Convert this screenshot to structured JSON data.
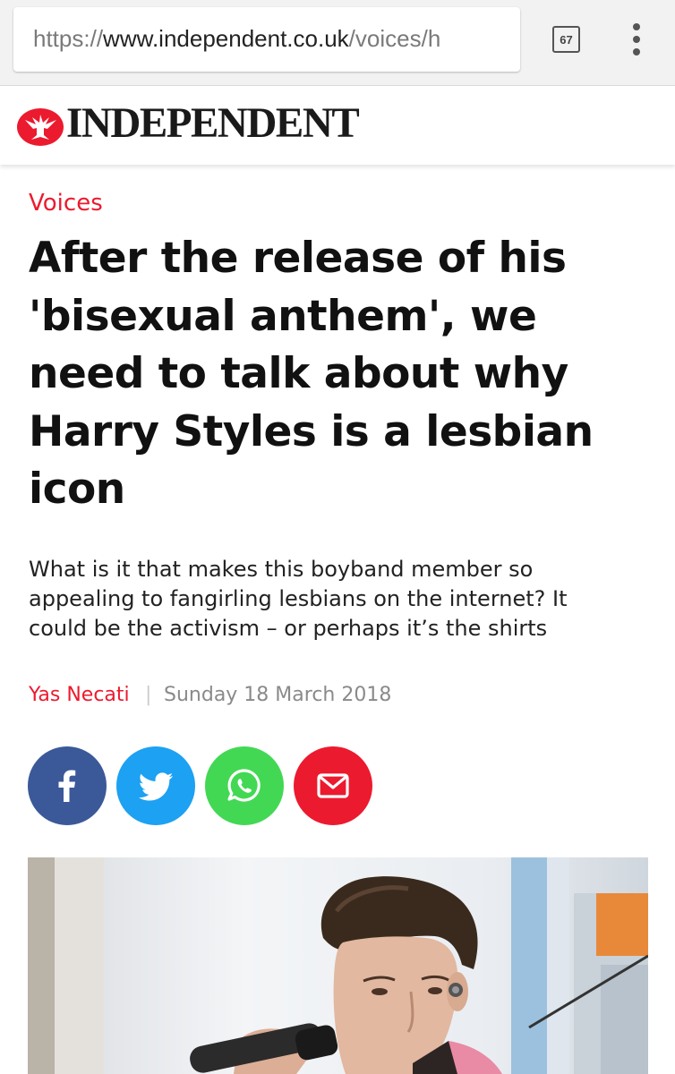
{
  "browser": {
    "url_scheme": "https://",
    "url_host": "www.independent.co.uk",
    "url_path": "/voices/h",
    "tab_count": "67"
  },
  "masthead": {
    "brand": "INDEPENDENT",
    "brand_color": "#ec1a2e"
  },
  "article": {
    "section": "Voices",
    "headline_lines": [
      "After the release of his",
      "'bisexual anthem', we",
      "need to talk about why",
      "Harry Styles is a lesbian",
      "icon"
    ],
    "standfirst_lines": [
      "What is it that makes this boyband member so",
      "appealing to fangirling lesbians on the internet? It",
      "could be the activism – or perhaps it’s the shirts"
    ],
    "author": "Yas Necati",
    "separator": "|",
    "date": "Sunday 18 March 2018"
  },
  "share": [
    {
      "icon": "facebook-icon",
      "color": "#3b5999"
    },
    {
      "icon": "twitter-icon",
      "color": "#1da1f2"
    },
    {
      "icon": "whatsapp-icon",
      "color": "#43d854"
    },
    {
      "icon": "email-icon",
      "color": "#ec1a2e"
    }
  ]
}
